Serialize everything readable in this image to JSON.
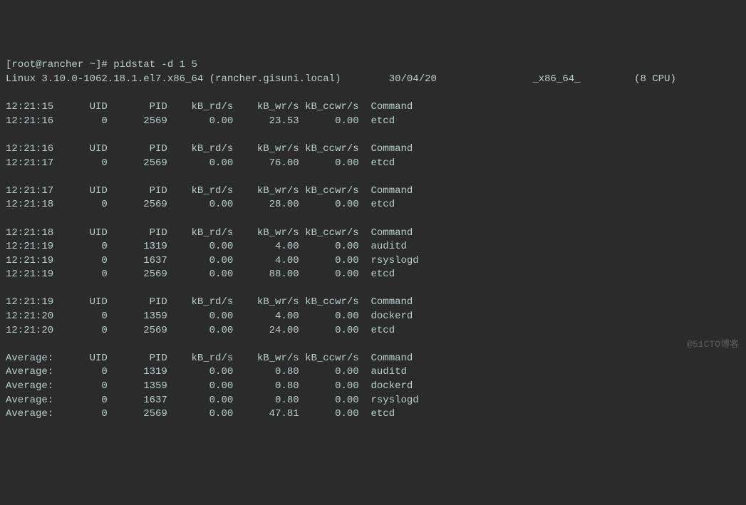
{
  "prompt": "[root@rancher ~]# pidstat -d 1 5",
  "sysline": {
    "kernel": "Linux 3.10.0-1062.18.1.el7.x86_64 (rancher.gisuni.local)",
    "date": "30/04/20",
    "arch": "_x86_64_",
    "cpu": "(8 CPU)"
  },
  "header_cols": [
    "UID",
    "PID",
    "kB_rd/s",
    "kB_wr/s",
    "kB_ccwr/s",
    "Command"
  ],
  "groups": [
    {
      "header_time": "12:21:15",
      "rows": [
        {
          "time": "12:21:16",
          "uid": "0",
          "pid": "2569",
          "rd": "0.00",
          "wr": "23.53",
          "ccwr": "0.00",
          "cmd": "etcd"
        }
      ]
    },
    {
      "header_time": "12:21:16",
      "rows": [
        {
          "time": "12:21:17",
          "uid": "0",
          "pid": "2569",
          "rd": "0.00",
          "wr": "76.00",
          "ccwr": "0.00",
          "cmd": "etcd"
        }
      ]
    },
    {
      "header_time": "12:21:17",
      "rows": [
        {
          "time": "12:21:18",
          "uid": "0",
          "pid": "2569",
          "rd": "0.00",
          "wr": "28.00",
          "ccwr": "0.00",
          "cmd": "etcd"
        }
      ]
    },
    {
      "header_time": "12:21:18",
      "rows": [
        {
          "time": "12:21:19",
          "uid": "0",
          "pid": "1319",
          "rd": "0.00",
          "wr": "4.00",
          "ccwr": "0.00",
          "cmd": "auditd"
        },
        {
          "time": "12:21:19",
          "uid": "0",
          "pid": "1637",
          "rd": "0.00",
          "wr": "4.00",
          "ccwr": "0.00",
          "cmd": "rsyslogd"
        },
        {
          "time": "12:21:19",
          "uid": "0",
          "pid": "2569",
          "rd": "0.00",
          "wr": "88.00",
          "ccwr": "0.00",
          "cmd": "etcd"
        }
      ]
    },
    {
      "header_time": "12:21:19",
      "rows": [
        {
          "time": "12:21:20",
          "uid": "0",
          "pid": "1359",
          "rd": "0.00",
          "wr": "4.00",
          "ccwr": "0.00",
          "cmd": "dockerd"
        },
        {
          "time": "12:21:20",
          "uid": "0",
          "pid": "2569",
          "rd": "0.00",
          "wr": "24.00",
          "ccwr": "0.00",
          "cmd": "etcd"
        }
      ]
    }
  ],
  "average": {
    "label": "Average:",
    "rows": [
      {
        "uid": "0",
        "pid": "1319",
        "rd": "0.00",
        "wr": "0.80",
        "ccwr": "0.00",
        "cmd": "auditd"
      },
      {
        "uid": "0",
        "pid": "1359",
        "rd": "0.00",
        "wr": "0.80",
        "ccwr": "0.00",
        "cmd": "dockerd"
      },
      {
        "uid": "0",
        "pid": "1637",
        "rd": "0.00",
        "wr": "0.80",
        "ccwr": "0.00",
        "cmd": "rsyslogd"
      },
      {
        "uid": "0",
        "pid": "2569",
        "rd": "0.00",
        "wr": "47.81",
        "ccwr": "0.00",
        "cmd": "etcd"
      }
    ]
  },
  "watermark": "@51CTO博客"
}
